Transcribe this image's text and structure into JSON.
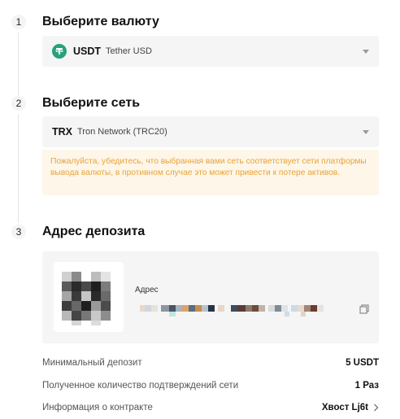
{
  "steps": [
    {
      "number": "1",
      "title": "Выберите валюту"
    },
    {
      "number": "2",
      "title": "Выберите сеть"
    },
    {
      "number": "3",
      "title": "Адрес депозита"
    }
  ],
  "currency_select": {
    "symbol": "USDT",
    "name": "Tether USD",
    "icon": "tether-icon",
    "icon_color": "#26a17b"
  },
  "network_select": {
    "symbol": "TRX",
    "name": "Tron Network (TRC20)"
  },
  "warning": {
    "text": "Пожалуйста, убедитесь, что выбранная вами сеть соответствует сети платформы вывода валюты, в противном случае это может привести к потере активов.",
    "color": "#e8a33a",
    "background": "#fef6e8"
  },
  "deposit": {
    "address_label": "Адрес"
  },
  "info": [
    {
      "label": "Минимальный депозит",
      "value": "5 USDT"
    },
    {
      "label": "Полученное количество подтверждений сети",
      "value": "1 Раз"
    },
    {
      "label": "Информация о контракте",
      "value": "Хвост Lj6t"
    }
  ]
}
